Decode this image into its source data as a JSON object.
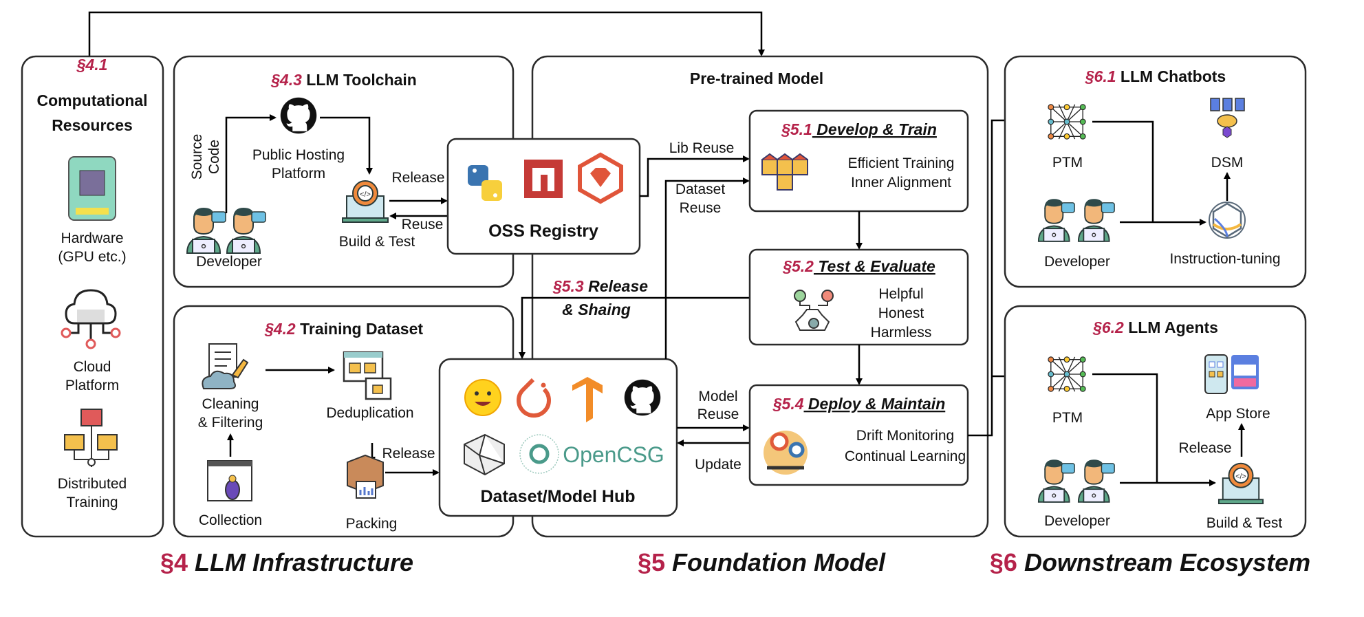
{
  "colors": {
    "section_number": "#b5224a",
    "opencsg": "#4a9a8a",
    "box_stroke": "#2b2b2b"
  },
  "infra": {
    "compute": {
      "num": "§4.1",
      "line1": "Computational",
      "line2": "Resources",
      "hardware": [
        "Hardware",
        "(GPU etc.)"
      ],
      "cloud": [
        "Cloud",
        "Platform"
      ],
      "distributed": [
        "Distributed",
        "Training"
      ]
    },
    "toolchain": {
      "num": "§4.3",
      "title": " LLM Toolchain",
      "source": [
        "Source",
        "Code"
      ],
      "hosting": [
        "Public Hosting",
        "Platform"
      ],
      "developer": "Developer",
      "build": "Build & Test",
      "release": "Release",
      "reuse": "Reuse"
    },
    "dataset": {
      "num": "§4.2",
      "title": " Training Dataset",
      "cleaning": [
        "Cleaning",
        "& Filtering"
      ],
      "dedup": "Deduplication",
      "release": "Release",
      "packing": "Packing",
      "collection": "Collection"
    },
    "oss": {
      "label": "OSS Registry"
    },
    "hub": {
      "label": "Dataset/Model Hub",
      "opencsg": "OpenCSG"
    }
  },
  "foundation": {
    "title": "Pre-trained Model",
    "lib_reuse": "Lib Reuse",
    "dataset_reuse": [
      "Dataset",
      "Reuse"
    ],
    "release_sharing": {
      "num": "§5.3",
      "line1": " Release",
      "line2": "& Shaing"
    },
    "model_reuse": [
      "Model",
      "Reuse"
    ],
    "update": "Update",
    "s51": {
      "num": "§5.1",
      "title": " Develop & Train",
      "items": [
        "Efficient Training",
        "Inner Alignment"
      ]
    },
    "s52": {
      "num": "§5.2",
      "title": " Test & Evaluate",
      "items": [
        "Helpful",
        "Honest",
        "Harmless"
      ]
    },
    "s54": {
      "num": "§5.4",
      "title": " Deploy & Maintain",
      "items": [
        "Drift Monitoring",
        "Continual Learning"
      ]
    }
  },
  "downstream": {
    "chatbots": {
      "num": "§6.1",
      "title": " LLM Chatbots",
      "ptm": "PTM",
      "dsm": "DSM",
      "developer": "Developer",
      "tuning": "Instruction-tuning"
    },
    "agents": {
      "num": "§6.2",
      "title": " LLM Agents",
      "ptm": "PTM",
      "app_store": "App Store",
      "release": "Release",
      "developer": "Developer",
      "build": "Build & Test"
    }
  },
  "footer": {
    "s4": {
      "num": "§4",
      "title": " LLM Infrastructure"
    },
    "s5": {
      "num": "§5",
      "title": " Foundation Model"
    },
    "s6": {
      "num": "§6",
      "title": " Downstream Ecosystem"
    }
  }
}
